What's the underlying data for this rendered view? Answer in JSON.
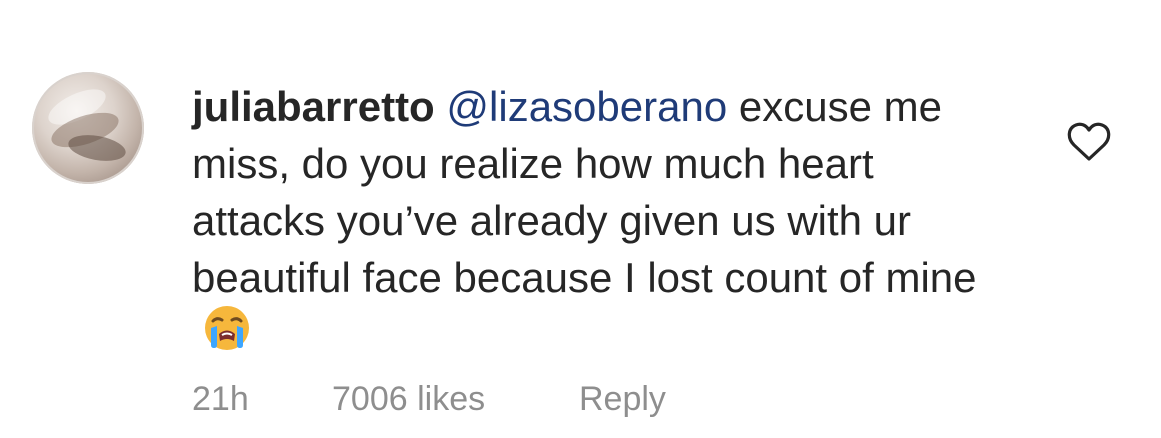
{
  "comment": {
    "username": "juliabarretto",
    "mention": "@lizasoberano",
    "text": " excuse me miss, do you realize how much heart attacks you’ve already given us with ur beautiful face because I lost count of mine",
    "emoji_icon": "crying-face-icon",
    "meta": {
      "time": "21h",
      "likes": "7006 likes",
      "reply": "Reply"
    },
    "like_icon": "heart-icon",
    "colors": {
      "mention": "#1f3b78",
      "text": "#262626",
      "meta": "#8e8e8e"
    }
  }
}
